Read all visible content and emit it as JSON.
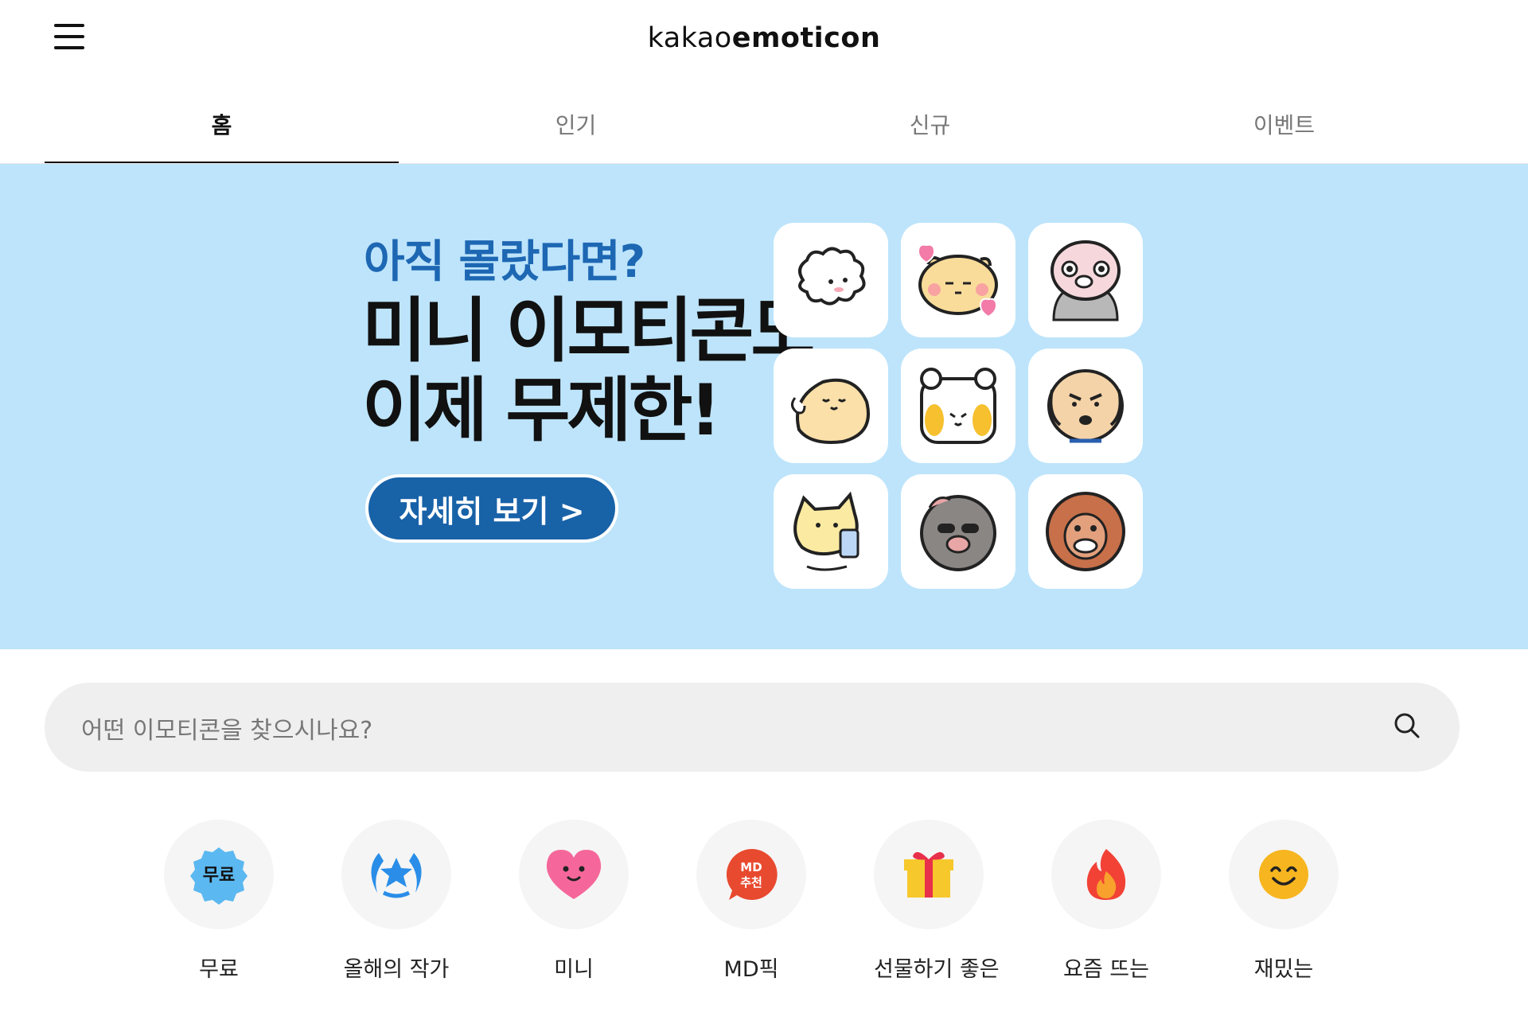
{
  "header": {
    "logo_light": "kakao",
    "logo_bold": "emoticon"
  },
  "tabs": [
    {
      "label": "홈",
      "active": true
    },
    {
      "label": "인기",
      "active": false
    },
    {
      "label": "신규",
      "active": false
    },
    {
      "label": "이벤트",
      "active": false
    }
  ],
  "banner": {
    "subtitle": "아직 몰랐다면?",
    "title_line1": "미니 이모티콘도",
    "title_line2": "이제 무제한!",
    "button_label": "자세히 보기 >",
    "background": "#bde4fb",
    "accent": "#1862a8"
  },
  "search": {
    "placeholder": "어떤 이모티콘을 찾으시나요?"
  },
  "categories": [
    {
      "label": "무료",
      "icon": "free-badge-icon"
    },
    {
      "label": "올해의 작가",
      "icon": "laurel-star-icon"
    },
    {
      "label": "미니",
      "icon": "heart-face-icon"
    },
    {
      "label": "MD픽",
      "icon": "md-recommend-icon",
      "icon_text_1": "MD",
      "icon_text_2": "추천"
    },
    {
      "label": "선물하기 좋은",
      "icon": "gift-icon"
    },
    {
      "label": "요즘 뜨는",
      "icon": "fire-icon"
    },
    {
      "label": "재밌는",
      "icon": "smile-face-icon"
    }
  ]
}
